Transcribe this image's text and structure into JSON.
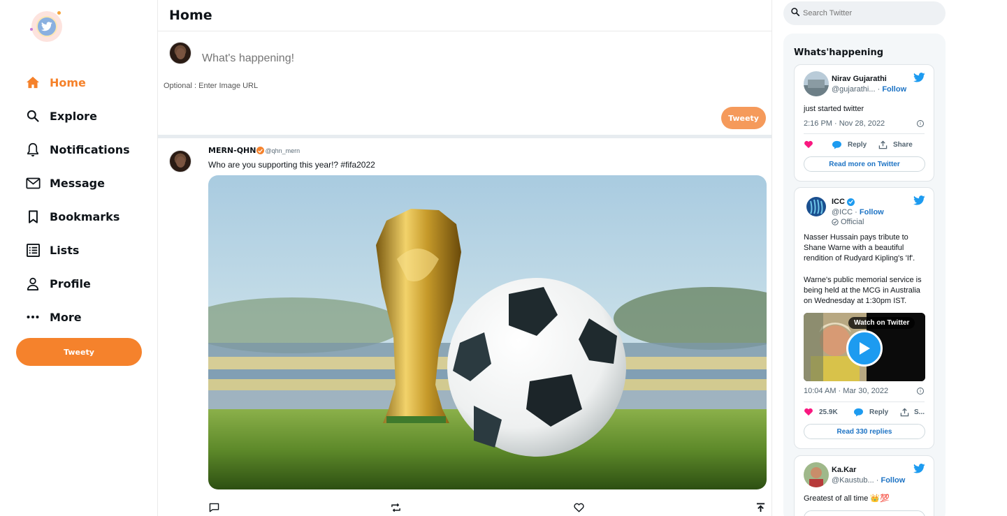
{
  "nav": {
    "items": [
      {
        "label": "Home",
        "icon": "home-icon"
      },
      {
        "label": "Explore",
        "icon": "search-icon"
      },
      {
        "label": "Notifications",
        "icon": "bell-icon"
      },
      {
        "label": "Message",
        "icon": "mail-icon"
      },
      {
        "label": "Bookmarks",
        "icon": "bookmark-icon"
      },
      {
        "label": "Lists",
        "icon": "list-icon"
      },
      {
        "label": "Profile",
        "icon": "person-icon"
      },
      {
        "label": "More",
        "icon": "more-icon"
      }
    ],
    "tweety_label": "Tweety"
  },
  "main": {
    "title": "Home",
    "compose": {
      "placeholder": "What's happening!",
      "image_url_label": "Optional : Enter Image URL",
      "submit_label": "Tweety"
    },
    "post": {
      "name": "MERN-QHN",
      "handle": "@qhn_mern",
      "text": "Who are you supporting this year!? #fifa2022"
    }
  },
  "search": {
    "placeholder": "Search Twitter"
  },
  "happening": {
    "title": "Whats'happening",
    "cards": [
      {
        "name": "Nirav Gujarathi",
        "handle": "@gujarathi...",
        "follow": "Follow",
        "text": "just started twitter",
        "time": "2:16 PM · Nov 28, 2022",
        "reply": "Reply",
        "share": "Share",
        "button": "Read more on Twitter"
      },
      {
        "name": "ICC",
        "handle": "@ICC",
        "follow": "Follow",
        "official": "Official",
        "text_1": "Nasser Hussain pays tribute to Shane Warne with a beautiful rendition of Rudyard Kipling's 'If'.",
        "text_2": "Warne's public memorial service is being held at the MCG in Australia on Wednesday at 1:30pm IST.",
        "video_label": "Watch on Twitter",
        "time": "10:04 AM · Mar 30, 2022",
        "likes": "25.9K",
        "reply": "Reply",
        "share": "S...",
        "button": "Read 330 replies"
      },
      {
        "name": "Ka.Kar",
        "handle": "@Kaustub...",
        "follow": "Follow",
        "text": "Greatest of all time 👑💯"
      }
    ]
  },
  "colors": {
    "accent": "#f5822c",
    "twitter_blue": "#1d9bf0",
    "link_blue": "#1d73c4",
    "like_pink": "#f91880"
  }
}
